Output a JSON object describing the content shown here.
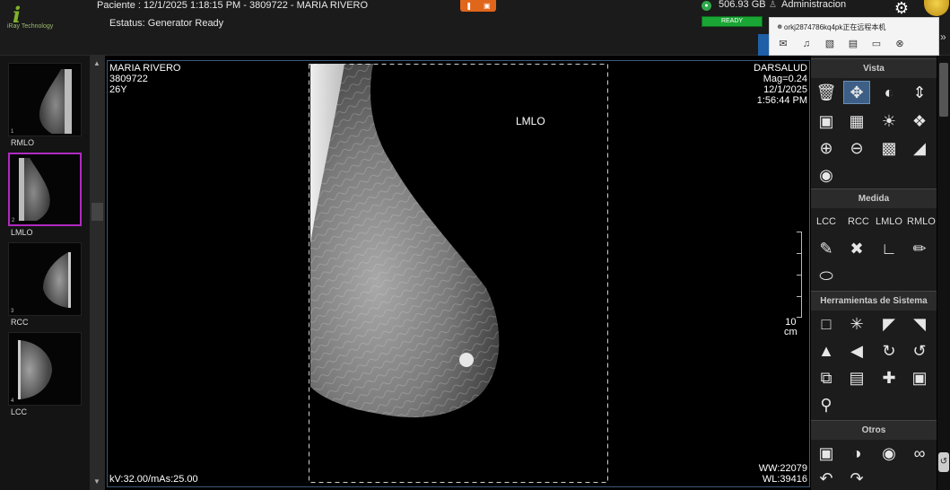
{
  "header": {
    "patient_line": "Paciente  :  12/1/2025 1:18:15 PM - 3809722 - MARIA RIVERO",
    "status_line": "Estatus:  Generator Ready",
    "disk_free": "506.93 GB",
    "user": "Administracion",
    "ready_badge": "READY",
    "logo_text": "i",
    "logo_sub": "iRay Technology"
  },
  "remote_popup": {
    "title": "orkj2874786kq4pk正在远程本机",
    "icons": [
      "chat-icon",
      "mic-icon",
      "screen-share-icon",
      "text-icon",
      "folder-icon",
      "close-icon"
    ]
  },
  "thumbnails": [
    {
      "num": "1",
      "label": "RMLO",
      "active": false
    },
    {
      "num": "2",
      "label": "LMLO",
      "active": true
    },
    {
      "num": "3",
      "label": "RCC",
      "active": false
    },
    {
      "num": "4",
      "label": "LCC",
      "active": false
    }
  ],
  "viewer": {
    "top_left": [
      "MARIA RIVERO",
      "3809722",
      "26Y"
    ],
    "top_right": [
      "DARSALUD",
      "Mag=0.24",
      "12/1/2025",
      "1:56:44 PM"
    ],
    "bottom_left": "kV:32.00/mAs:25.00",
    "bottom_right": [
      "WW:22079",
      "WL:39416"
    ],
    "view_label": "LMLO",
    "scale_value": "10",
    "scale_unit": "cm"
  },
  "tools": {
    "vista_title": "Vista",
    "medida_title": "Medida",
    "medida_views": [
      "LCC",
      "RCC",
      "LMLO",
      "RMLO"
    ],
    "sistema_title": "Herramientas de Sistema",
    "otros_title": "Otros"
  },
  "colors": {
    "accent": "#3d5f86",
    "active_thumb": "#b02ac0",
    "ready": "#1aa634",
    "orange": "#e0661b"
  }
}
